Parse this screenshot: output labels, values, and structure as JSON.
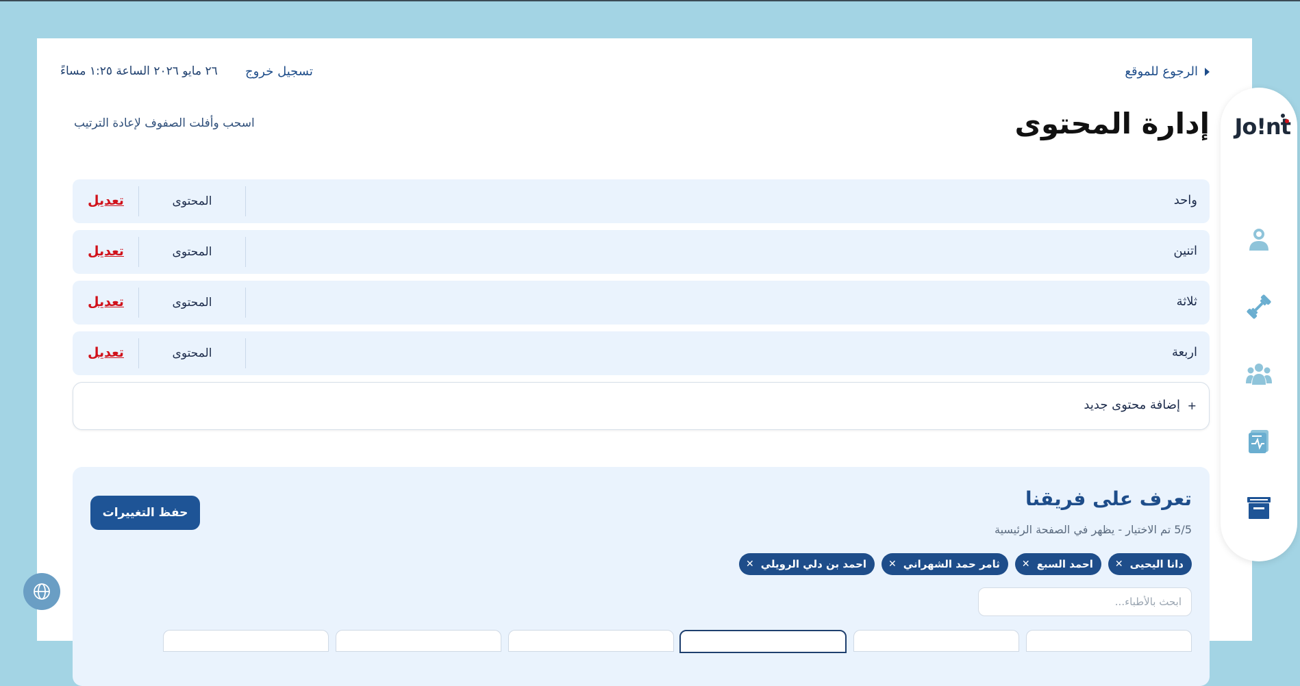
{
  "header": {
    "back_label": "الرجوع للموقع",
    "logout_label": "تسجيل خروج",
    "datetime": "٢٦ مايو ٢٠٢٦ الساعة ١:٢٥ مساءً"
  },
  "page": {
    "title": "إدارة المحتوى",
    "hint": "اسحب وأفلت الصفوف لإعادة الترتيب"
  },
  "rows": [
    {
      "name": "واحد",
      "type": "المحتوى",
      "edit_label": "تعديل"
    },
    {
      "name": "اتنين",
      "type": "المحتوى",
      "edit_label": "تعديل"
    },
    {
      "name": "ثلاثة",
      "type": "المحتوى",
      "edit_label": "تعديل"
    },
    {
      "name": "اربعة",
      "type": "المحتوى",
      "edit_label": "تعديل"
    }
  ],
  "add_row": {
    "plus": "+",
    "label": "إضافة محتوى جديد"
  },
  "team": {
    "title": "تعرف على فريقنا",
    "count_text": "5/5 تم الاختيار - يظهر في الصفحة الرئيسية",
    "save_label": "حفظ التغييرات",
    "chips": [
      {
        "name": "دانا اليحيى",
        "remove": "✕"
      },
      {
        "name": "احمد السبع",
        "remove": "✕"
      },
      {
        "name": "ثامر حمد الشهراني",
        "remove": "✕"
      },
      {
        "name": "احمد بن دلي الرويلي",
        "remove": "✕"
      }
    ],
    "search_placeholder": "ابحث بالأطباء..."
  },
  "sidebar": {
    "logo_text": "Jo!nt",
    "icons": [
      "user-icon",
      "dumbbell-icon",
      "group-icon",
      "medical-report-icon",
      "archive-icon"
    ]
  },
  "colors": {
    "background": "#a3d4e4",
    "primary": "#1e4d8a",
    "edit_red": "#d0121b",
    "row_bg": "#eaf3fd"
  },
  "language_icon": "globe-icon"
}
